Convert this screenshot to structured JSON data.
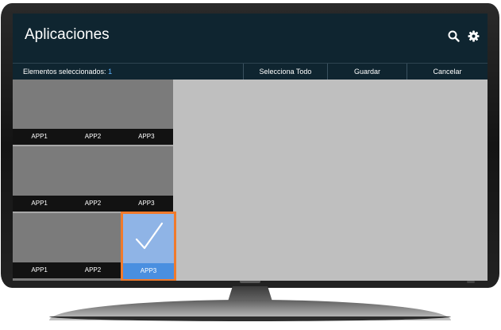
{
  "header": {
    "title": "Aplicaciones",
    "icons": [
      "search-icon",
      "gear-icon"
    ]
  },
  "toolbar": {
    "selected_label": "Elementos seleccionados:",
    "selected_count": "1",
    "select_all_label": "Selecciona Todo",
    "save_label": "Guardar",
    "cancel_label": "Cancelar"
  },
  "grid": {
    "rows": [
      {
        "labels": [
          "APP1",
          "APP2",
          "APP3"
        ]
      },
      {
        "labels": [
          "APP1",
          "APP2",
          "APP3"
        ]
      },
      {
        "labels": [
          "APP1",
          "APP2",
          "APP3"
        ]
      }
    ],
    "selected": {
      "row": 3,
      "label": "APP3"
    }
  },
  "colors": {
    "header_bg": "#0f2530",
    "accent_count": "#5fb4ff",
    "selection_border": "#f07a2c",
    "selection_fill": "#8fb4e6",
    "selection_label_bg": "#4a8fe0"
  }
}
